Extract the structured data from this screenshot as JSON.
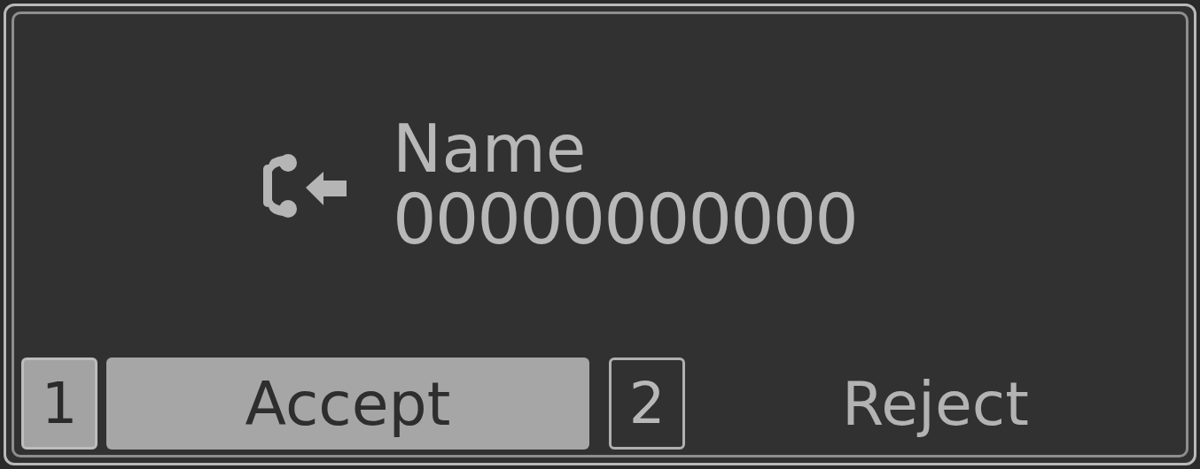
{
  "caller": {
    "name": "Name",
    "number": "00000000000"
  },
  "soft_keys": [
    {
      "key": "1",
      "label": "Accept",
      "selected": true
    },
    {
      "key": "2",
      "label": "Reject",
      "selected": false
    }
  ]
}
